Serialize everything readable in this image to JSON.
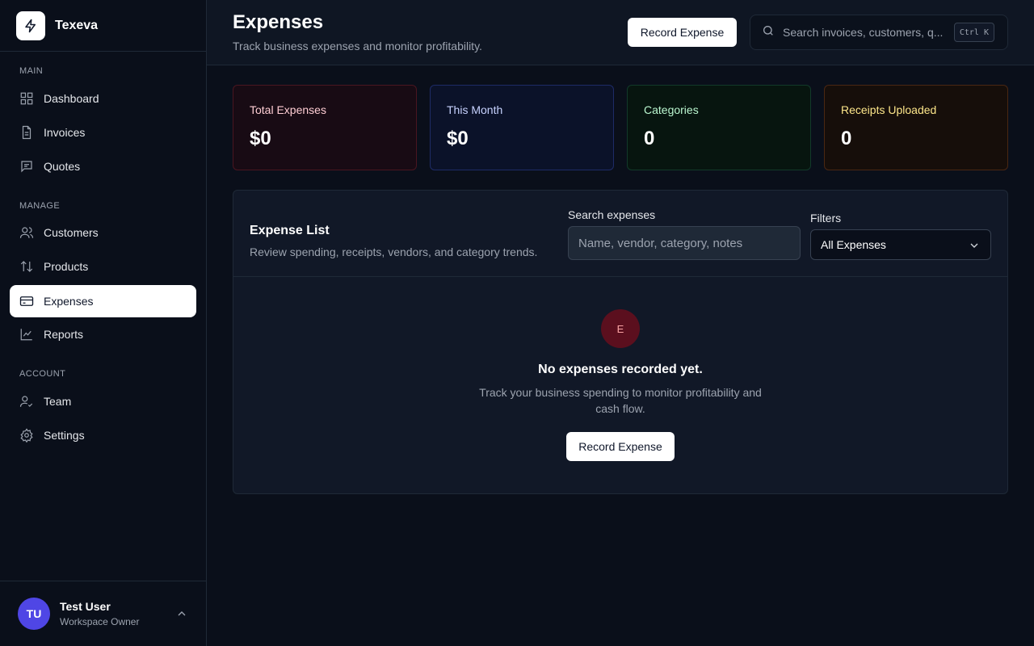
{
  "app": {
    "name": "Texeva"
  },
  "sidebar": {
    "sections": [
      {
        "label": "MAIN"
      },
      {
        "label": "MANAGE"
      },
      {
        "label": "ACCOUNT"
      }
    ],
    "items": [
      {
        "label": "Dashboard",
        "icon": "grid-icon"
      },
      {
        "label": "Invoices",
        "icon": "file-icon"
      },
      {
        "label": "Quotes",
        "icon": "message-square-icon"
      },
      {
        "label": "Customers",
        "icon": "users-icon"
      },
      {
        "label": "Products",
        "icon": "arrows-up-down-icon"
      },
      {
        "label": "Expenses",
        "icon": "credit-card-icon",
        "active": true
      },
      {
        "label": "Reports",
        "icon": "line-chart-icon"
      },
      {
        "label": "Team",
        "icon": "user-check-icon"
      },
      {
        "label": "Settings",
        "icon": "gear-icon"
      }
    ],
    "user": {
      "initials": "TU",
      "name": "Test User",
      "role": "Workspace Owner"
    }
  },
  "header": {
    "title": "Expenses",
    "subtitle": "Track business expenses and monitor profitability.",
    "record_button": "Record Expense",
    "search_placeholder": "Search invoices, customers, q...",
    "shortcut": "Ctrl K"
  },
  "stats": [
    {
      "label": "Total Expenses",
      "value": "$0"
    },
    {
      "label": "This Month",
      "value": "$0"
    },
    {
      "label": "Categories",
      "value": "0"
    },
    {
      "label": "Receipts Uploaded",
      "value": "0"
    }
  ],
  "expense_list": {
    "title": "Expense List",
    "description": "Review spending, receipts, vendors, and category trends.",
    "search_label": "Search expenses",
    "search_placeholder": "Name, vendor, category, notes",
    "filters_label": "Filters",
    "filter_value": "All Expenses",
    "empty": {
      "icon_letter": "E",
      "title": "No expenses recorded yet.",
      "description": "Track your business spending to monitor profitability and cash flow.",
      "button": "Record Expense"
    }
  },
  "colors": {
    "background": "#0a0f1a",
    "panel": "#111827",
    "accent_user": "#4f46e5",
    "empty_icon_bg": "#5b0f1e"
  }
}
